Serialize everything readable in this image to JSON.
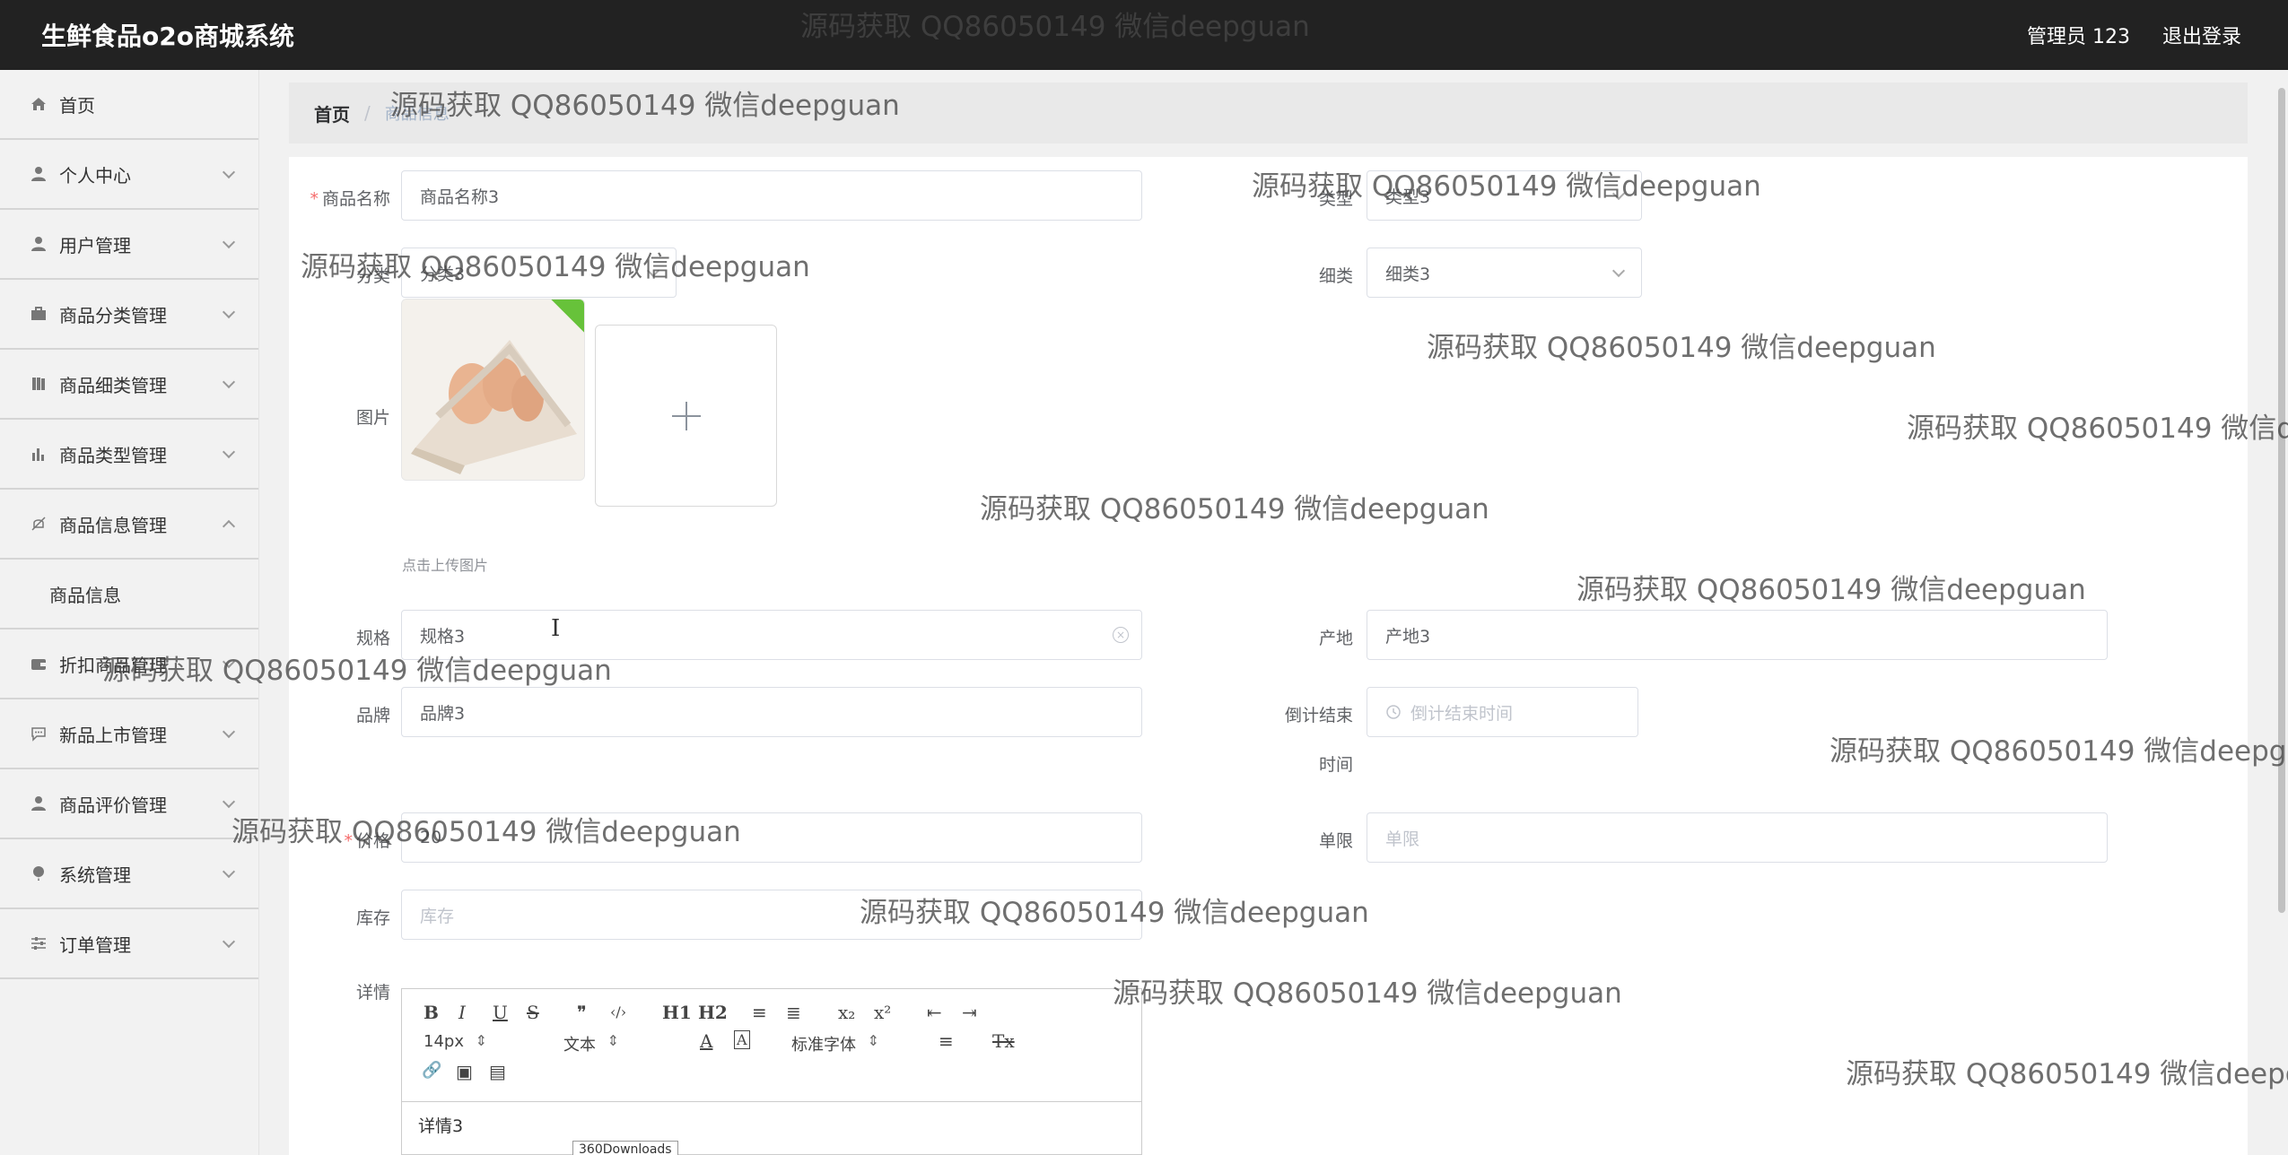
{
  "app": {
    "title": "生鲜食品o2o商城系统",
    "user": "管理员 123",
    "logout": "退出登录"
  },
  "sidebar": {
    "items": [
      {
        "label": "首页",
        "icon": "home-icon"
      },
      {
        "label": "个人中心",
        "icon": "user-icon"
      },
      {
        "label": "用户管理",
        "icon": "user-icon"
      },
      {
        "label": "商品分类管理",
        "icon": "briefcase-icon"
      },
      {
        "label": "商品细类管理",
        "icon": "book-icon"
      },
      {
        "label": "商品类型管理",
        "icon": "bar-chart-icon"
      },
      {
        "label": "商品信息管理",
        "icon": "bell-off-icon"
      },
      {
        "label": "折扣商品管理",
        "icon": "wallet-icon"
      },
      {
        "label": "新品上市管理",
        "icon": "chat-icon"
      },
      {
        "label": "商品评价管理",
        "icon": "user-icon"
      },
      {
        "label": "系统管理",
        "icon": "balloon-icon"
      },
      {
        "label": "订单管理",
        "icon": "sliders-icon"
      }
    ],
    "submenu": {
      "label": "商品信息"
    }
  },
  "breadcrumb": {
    "home": "首页",
    "separator": "/",
    "current": "商品信息"
  },
  "form": {
    "name": {
      "label": "商品名称",
      "value": "商品名称3"
    },
    "type": {
      "label": "类型",
      "value": "类型3"
    },
    "category": {
      "label": "分类",
      "value": "分类3"
    },
    "subcategory": {
      "label": "细类",
      "value": "细类3"
    },
    "image": {
      "label": "图片",
      "hint": "点击上传图片"
    },
    "spec": {
      "label": "规格",
      "value": "规格3"
    },
    "origin": {
      "label": "产地",
      "value": "产地3"
    },
    "brand": {
      "label": "品牌",
      "value": "品牌3"
    },
    "countdown": {
      "label_line1": "倒计结束",
      "label_line2": "时间",
      "placeholder": "倒计结束时间"
    },
    "price": {
      "label": "价格",
      "value": "20"
    },
    "limit": {
      "label": "单限",
      "placeholder": "单限"
    },
    "stock": {
      "label": "库存",
      "placeholder": "库存"
    },
    "detail": {
      "label": "详情",
      "content": "详情3"
    }
  },
  "editor": {
    "bold": "B",
    "italic": "I",
    "underline": "U",
    "strike": "S",
    "quote": "❞",
    "code": "‹/›",
    "h1": "H1",
    "h2": "H2",
    "ol": "≡",
    "ul": "≣",
    "sub": "x₂",
    "sup": "x²",
    "outdent": "⇤",
    "indent": "⇥",
    "size": "14px",
    "header": "文本",
    "color": "A",
    "bg": "A",
    "font": "标准字体",
    "align": "≡",
    "clean": "Tx",
    "link": "🔗",
    "image": "▣",
    "video": "▤"
  },
  "tooltip": "360Downloads",
  "watermark": "源码获取 QQ86050149 微信deepguan"
}
